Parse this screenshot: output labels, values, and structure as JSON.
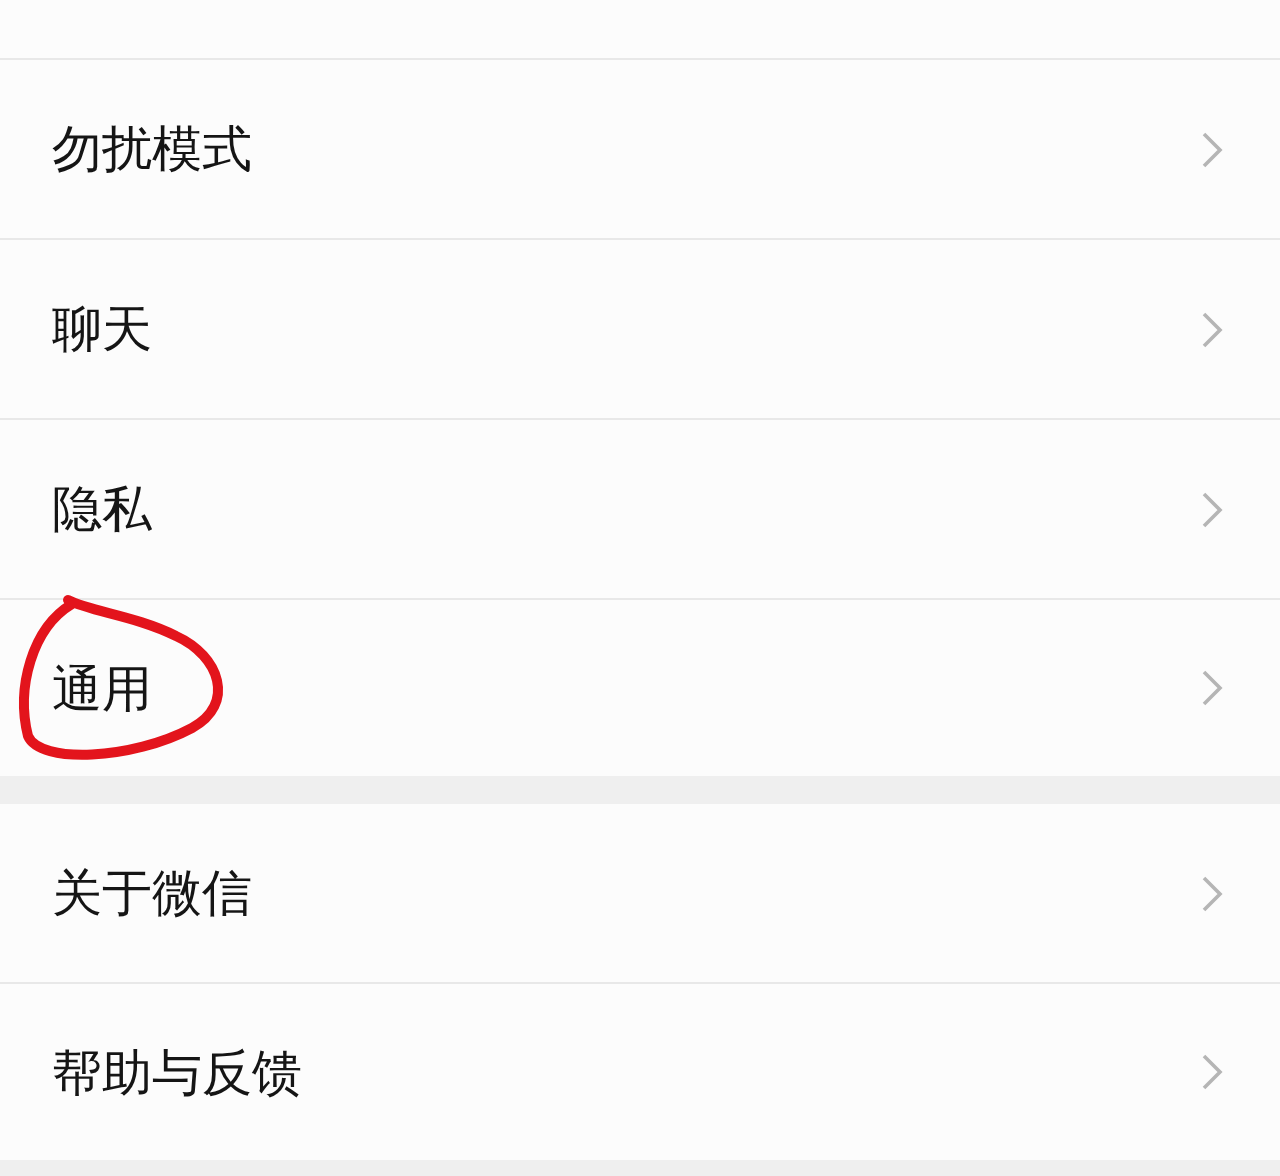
{
  "groups": [
    {
      "items": [
        {
          "label": "勿扰模式",
          "circled": false
        },
        {
          "label": "聊天",
          "circled": false
        },
        {
          "label": "隐私",
          "circled": false
        },
        {
          "label": "通用",
          "circled": true
        }
      ]
    },
    {
      "items": [
        {
          "label": "关于微信",
          "circled": false
        },
        {
          "label": "帮助与反馈",
          "circled": false
        }
      ]
    }
  ]
}
